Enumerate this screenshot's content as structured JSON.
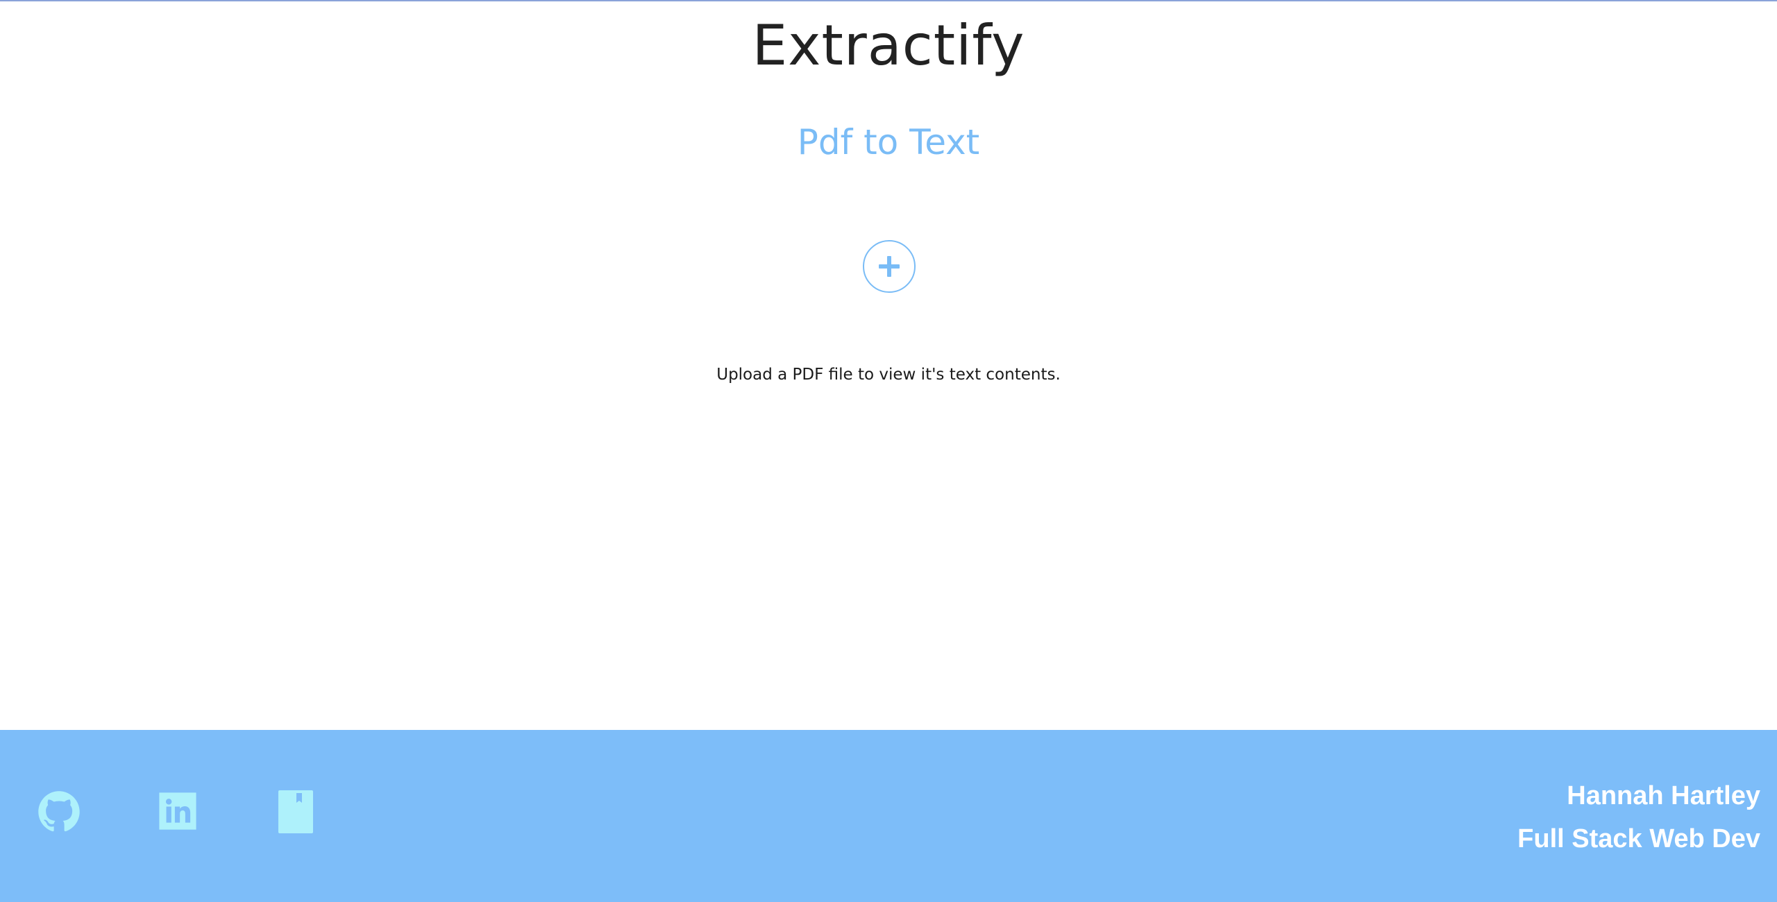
{
  "header": {
    "title": "Extractify",
    "subtitle": "Pdf to Text"
  },
  "upload": {
    "icon": "plus-icon",
    "hint": "Upload a PDF file to view it's text contents."
  },
  "footer": {
    "links": [
      {
        "icon": "github-icon"
      },
      {
        "icon": "linkedin-icon"
      },
      {
        "icon": "book-icon"
      }
    ],
    "author_name": "Hannah Hartley",
    "author_role": "Full Stack Web Dev"
  },
  "colors": {
    "accent": "#7abcf6",
    "footer_bg": "#7dbdf9",
    "footer_icons": "#aef1fb",
    "title": "#222222"
  }
}
